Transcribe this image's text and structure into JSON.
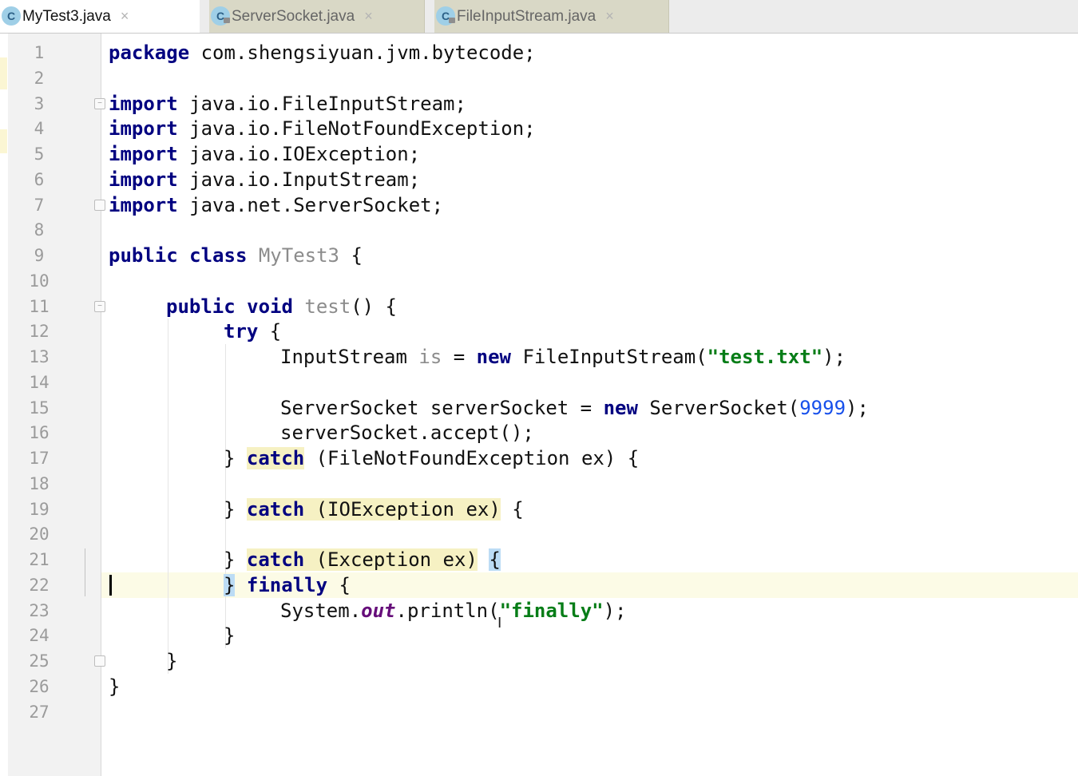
{
  "tabs": [
    {
      "name": "MyTest3.java",
      "icon": "C",
      "active": true
    },
    {
      "name": "ServerSocket.java",
      "icon": "C",
      "active": false
    },
    {
      "name": "FileInputStream.java",
      "icon": "C",
      "active": false
    }
  ],
  "close_glyph": "×",
  "line_numbers": [
    "1",
    "2",
    "3",
    "4",
    "5",
    "6",
    "7",
    "8",
    "9",
    "10",
    "11",
    "12",
    "13",
    "14",
    "15",
    "16",
    "17",
    "18",
    "19",
    "20",
    "21",
    "22",
    "23",
    "24",
    "25",
    "26",
    "27"
  ],
  "code": {
    "kw_package": "package",
    "package_name": " com.shengsiyuan.jvm.bytecode;",
    "kw_import": "import",
    "import_1": " java.io.FileInputStream;",
    "import_2": " java.io.FileNotFoundException;",
    "import_3": " java.io.IOException;",
    "import_4": " java.io.InputStream;",
    "import_5": " java.net.ServerSocket;",
    "kw_public": "public",
    "kw_class": "class",
    "class_name": "MyTest3",
    "open_brace": " {",
    "kw_void": "void",
    "method_name": "test",
    "method_parens": "() {",
    "kw_try": "try",
    "line13_type": "InputStream ",
    "line13_var": "is",
    "line13_eq": " = ",
    "kw_new": "new",
    "line13_ctor": " FileInputStream(",
    "line13_str": "\"test.txt\"",
    "line13_end": ");",
    "line15_decl": "ServerSocket serverSocket = ",
    "line15_ctor": " ServerSocket(",
    "line15_num": "9999",
    "line15_end": ");",
    "line16": "serverSocket.accept();",
    "close_brace": "}",
    "kw_catch": "catch",
    "catch1_args": " (FileNotFoundException ex)",
    "catch2_args": " (IOException ex)",
    "catch3_args": " (Exception ex)",
    "open_brace_only": "{",
    "kw_finally": "finally",
    "line23_a": "System.",
    "line23_out": "out",
    "line23_b": ".println(",
    "line23_str": "\"finally\"",
    "line23_end": ");"
  },
  "colors": {
    "keyword": "#000080",
    "string": "#067d17",
    "number": "#1750eb",
    "gray_ident": "#8c8c8c",
    "static_field": "#660e7a",
    "catch_highlight": "#f6f1c3",
    "brace_match": "#bcdcf5",
    "caret_line": "#fcfbe6"
  }
}
